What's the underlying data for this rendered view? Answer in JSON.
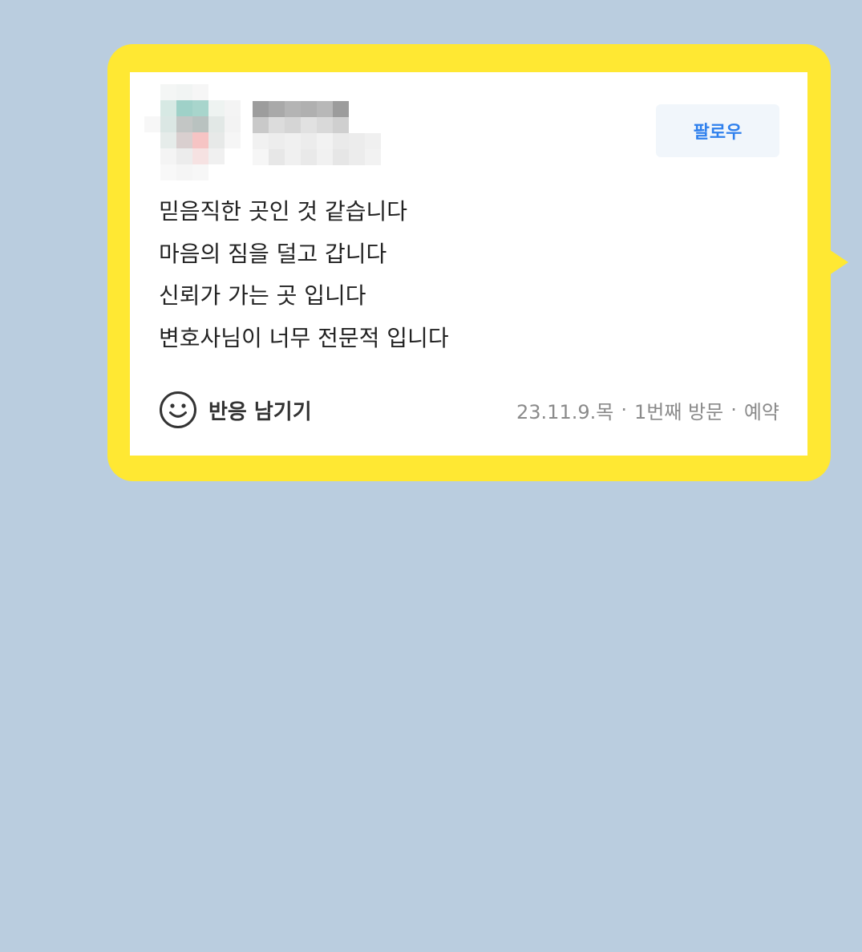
{
  "review": {
    "follow_label": "팔로우",
    "lines": [
      "믿음직한 곳인 것 같습니다",
      "마음의 짐을 덜고 갑니다",
      "신뢰가 가는 곳 입니다",
      "변호사님이 너무 전문적 입니다"
    ],
    "reaction_label": "반응 남기기",
    "date": "23.11.9.목",
    "visit": "1번째 방문",
    "type": "예약",
    "separator": "·"
  },
  "colors": {
    "background": "#bacddf",
    "bubble": "#ffe833",
    "follow_text": "#2f80ed"
  }
}
